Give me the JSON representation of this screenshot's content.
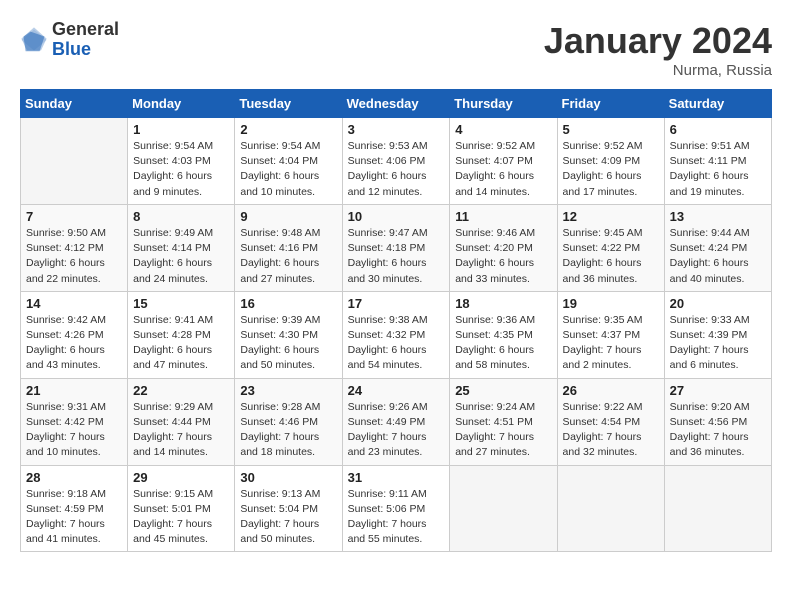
{
  "logo": {
    "general": "General",
    "blue": "Blue"
  },
  "title": "January 2024",
  "location": "Nurma, Russia",
  "days_of_week": [
    "Sunday",
    "Monday",
    "Tuesday",
    "Wednesday",
    "Thursday",
    "Friday",
    "Saturday"
  ],
  "weeks": [
    [
      {
        "day": "",
        "empty": true
      },
      {
        "day": "1",
        "sunrise": "Sunrise: 9:54 AM",
        "sunset": "Sunset: 4:03 PM",
        "daylight": "Daylight: 6 hours and 9 minutes."
      },
      {
        "day": "2",
        "sunrise": "Sunrise: 9:54 AM",
        "sunset": "Sunset: 4:04 PM",
        "daylight": "Daylight: 6 hours and 10 minutes."
      },
      {
        "day": "3",
        "sunrise": "Sunrise: 9:53 AM",
        "sunset": "Sunset: 4:06 PM",
        "daylight": "Daylight: 6 hours and 12 minutes."
      },
      {
        "day": "4",
        "sunrise": "Sunrise: 9:52 AM",
        "sunset": "Sunset: 4:07 PM",
        "daylight": "Daylight: 6 hours and 14 minutes."
      },
      {
        "day": "5",
        "sunrise": "Sunrise: 9:52 AM",
        "sunset": "Sunset: 4:09 PM",
        "daylight": "Daylight: 6 hours and 17 minutes."
      },
      {
        "day": "6",
        "sunrise": "Sunrise: 9:51 AM",
        "sunset": "Sunset: 4:11 PM",
        "daylight": "Daylight: 6 hours and 19 minutes."
      }
    ],
    [
      {
        "day": "7",
        "sunrise": "Sunrise: 9:50 AM",
        "sunset": "Sunset: 4:12 PM",
        "daylight": "Daylight: 6 hours and 22 minutes."
      },
      {
        "day": "8",
        "sunrise": "Sunrise: 9:49 AM",
        "sunset": "Sunset: 4:14 PM",
        "daylight": "Daylight: 6 hours and 24 minutes."
      },
      {
        "day": "9",
        "sunrise": "Sunrise: 9:48 AM",
        "sunset": "Sunset: 4:16 PM",
        "daylight": "Daylight: 6 hours and 27 minutes."
      },
      {
        "day": "10",
        "sunrise": "Sunrise: 9:47 AM",
        "sunset": "Sunset: 4:18 PM",
        "daylight": "Daylight: 6 hours and 30 minutes."
      },
      {
        "day": "11",
        "sunrise": "Sunrise: 9:46 AM",
        "sunset": "Sunset: 4:20 PM",
        "daylight": "Daylight: 6 hours and 33 minutes."
      },
      {
        "day": "12",
        "sunrise": "Sunrise: 9:45 AM",
        "sunset": "Sunset: 4:22 PM",
        "daylight": "Daylight: 6 hours and 36 minutes."
      },
      {
        "day": "13",
        "sunrise": "Sunrise: 9:44 AM",
        "sunset": "Sunset: 4:24 PM",
        "daylight": "Daylight: 6 hours and 40 minutes."
      }
    ],
    [
      {
        "day": "14",
        "sunrise": "Sunrise: 9:42 AM",
        "sunset": "Sunset: 4:26 PM",
        "daylight": "Daylight: 6 hours and 43 minutes."
      },
      {
        "day": "15",
        "sunrise": "Sunrise: 9:41 AM",
        "sunset": "Sunset: 4:28 PM",
        "daylight": "Daylight: 6 hours and 47 minutes."
      },
      {
        "day": "16",
        "sunrise": "Sunrise: 9:39 AM",
        "sunset": "Sunset: 4:30 PM",
        "daylight": "Daylight: 6 hours and 50 minutes."
      },
      {
        "day": "17",
        "sunrise": "Sunrise: 9:38 AM",
        "sunset": "Sunset: 4:32 PM",
        "daylight": "Daylight: 6 hours and 54 minutes."
      },
      {
        "day": "18",
        "sunrise": "Sunrise: 9:36 AM",
        "sunset": "Sunset: 4:35 PM",
        "daylight": "Daylight: 6 hours and 58 minutes."
      },
      {
        "day": "19",
        "sunrise": "Sunrise: 9:35 AM",
        "sunset": "Sunset: 4:37 PM",
        "daylight": "Daylight: 7 hours and 2 minutes."
      },
      {
        "day": "20",
        "sunrise": "Sunrise: 9:33 AM",
        "sunset": "Sunset: 4:39 PM",
        "daylight": "Daylight: 7 hours and 6 minutes."
      }
    ],
    [
      {
        "day": "21",
        "sunrise": "Sunrise: 9:31 AM",
        "sunset": "Sunset: 4:42 PM",
        "daylight": "Daylight: 7 hours and 10 minutes."
      },
      {
        "day": "22",
        "sunrise": "Sunrise: 9:29 AM",
        "sunset": "Sunset: 4:44 PM",
        "daylight": "Daylight: 7 hours and 14 minutes."
      },
      {
        "day": "23",
        "sunrise": "Sunrise: 9:28 AM",
        "sunset": "Sunset: 4:46 PM",
        "daylight": "Daylight: 7 hours and 18 minutes."
      },
      {
        "day": "24",
        "sunrise": "Sunrise: 9:26 AM",
        "sunset": "Sunset: 4:49 PM",
        "daylight": "Daylight: 7 hours and 23 minutes."
      },
      {
        "day": "25",
        "sunrise": "Sunrise: 9:24 AM",
        "sunset": "Sunset: 4:51 PM",
        "daylight": "Daylight: 7 hours and 27 minutes."
      },
      {
        "day": "26",
        "sunrise": "Sunrise: 9:22 AM",
        "sunset": "Sunset: 4:54 PM",
        "daylight": "Daylight: 7 hours and 32 minutes."
      },
      {
        "day": "27",
        "sunrise": "Sunrise: 9:20 AM",
        "sunset": "Sunset: 4:56 PM",
        "daylight": "Daylight: 7 hours and 36 minutes."
      }
    ],
    [
      {
        "day": "28",
        "sunrise": "Sunrise: 9:18 AM",
        "sunset": "Sunset: 4:59 PM",
        "daylight": "Daylight: 7 hours and 41 minutes."
      },
      {
        "day": "29",
        "sunrise": "Sunrise: 9:15 AM",
        "sunset": "Sunset: 5:01 PM",
        "daylight": "Daylight: 7 hours and 45 minutes."
      },
      {
        "day": "30",
        "sunrise": "Sunrise: 9:13 AM",
        "sunset": "Sunset: 5:04 PM",
        "daylight": "Daylight: 7 hours and 50 minutes."
      },
      {
        "day": "31",
        "sunrise": "Sunrise: 9:11 AM",
        "sunset": "Sunset: 5:06 PM",
        "daylight": "Daylight: 7 hours and 55 minutes."
      },
      {
        "day": "",
        "empty": true
      },
      {
        "day": "",
        "empty": true
      },
      {
        "day": "",
        "empty": true
      }
    ]
  ]
}
